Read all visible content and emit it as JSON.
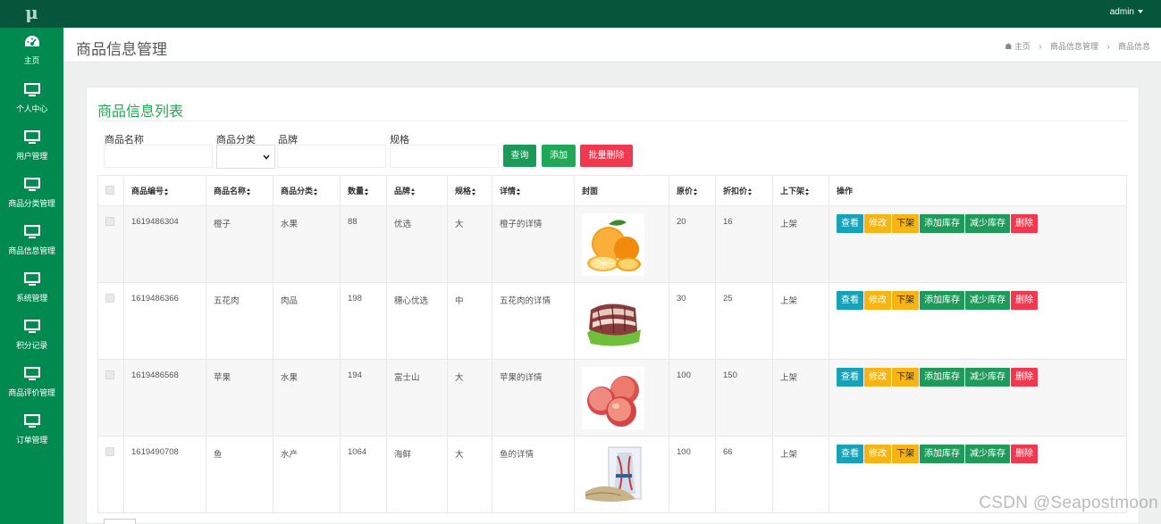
{
  "app": {
    "logo": "μ",
    "user": "admin"
  },
  "sidebar": {
    "items": [
      {
        "label": "主页",
        "icon": "dashboard-icon"
      },
      {
        "label": "个人中心",
        "icon": "monitor-icon"
      },
      {
        "label": "用户管理",
        "icon": "monitor-icon"
      },
      {
        "label": "商品分类管理",
        "icon": "monitor-icon"
      },
      {
        "label": "商品信息管理",
        "icon": "monitor-icon"
      },
      {
        "label": "系统管理",
        "icon": "monitor-icon"
      },
      {
        "label": "积分记录",
        "icon": "monitor-icon"
      },
      {
        "label": "商品评价管理",
        "icon": "monitor-icon"
      },
      {
        "label": "订单管理",
        "icon": "monitor-icon"
      }
    ]
  },
  "header": {
    "title": "商品信息管理",
    "breadcrumb": [
      "主页",
      "商品信息管理",
      "商品信息"
    ]
  },
  "panel": {
    "title": "商品信息列表"
  },
  "filters": {
    "name_label": "商品名称",
    "category_label": "商品分类",
    "brand_label": "品牌",
    "spec_label": "规格",
    "search_button": "查询",
    "add_button": "添加",
    "batch_delete_button": "批量删除"
  },
  "table": {
    "columns": [
      "商品编号",
      "商品名称",
      "商品分类",
      "数量",
      "品牌",
      "规格",
      "详情",
      "封面",
      "原价",
      "折扣价",
      "上下架",
      "操作"
    ],
    "actions": [
      "查看",
      "修改",
      "下架",
      "添加库存",
      "减少库存",
      "删除"
    ],
    "rows": [
      {
        "id": "1619486304",
        "name": "橙子",
        "category": "水果",
        "qty": "88",
        "brand": "优选",
        "spec": "大",
        "detail": "橙子的详情",
        "cover": "orange-image",
        "price": "20",
        "discount": "16",
        "status": "上架"
      },
      {
        "id": "1619486366",
        "name": "五花肉",
        "category": "肉品",
        "qty": "198",
        "brand": "穗心优选",
        "spec": "中",
        "detail": "五花肉的详情",
        "cover": "pork-image",
        "price": "30",
        "discount": "25",
        "status": "上架"
      },
      {
        "id": "1619486568",
        "name": "苹果",
        "category": "水果",
        "qty": "194",
        "brand": "富士山",
        "spec": "大",
        "detail": "苹果的详情",
        "cover": "apple-image",
        "price": "100",
        "discount": "150",
        "status": "上架"
      },
      {
        "id": "1619490708",
        "name": "鱼",
        "category": "水产",
        "qty": "1064",
        "brand": "海鲜",
        "spec": "大",
        "detail": "鱼的详情",
        "cover": "fish-image",
        "price": "100",
        "discount": "66",
        "status": "上架"
      }
    ]
  },
  "watermark": "CSDN @Seapostmoon",
  "colors": {
    "topbar": "#05563a",
    "sidebar": "#008a4f",
    "accent": "#1fa84f",
    "danger": "#f0394f",
    "warning": "#f6b515",
    "info": "#17a2b8"
  }
}
